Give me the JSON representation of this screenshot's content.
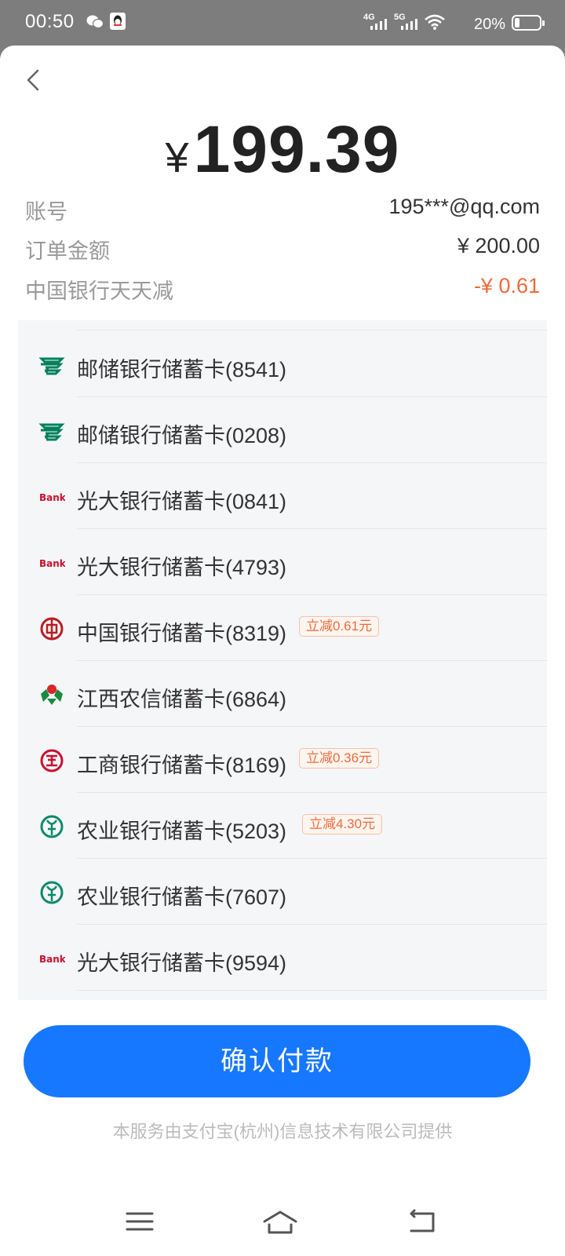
{
  "status": {
    "time": "00:50",
    "signal1": "4G",
    "signal2": "5G",
    "battery": "20%",
    "battery_level": 0.2
  },
  "header": {
    "back_icon": "chevron-left-icon"
  },
  "amount": {
    "currency": "¥",
    "value": "199.39"
  },
  "info": [
    {
      "label": "账号",
      "value": "195***@qq.com"
    },
    {
      "label": "订单金额",
      "value": "¥ 200.00"
    },
    {
      "label": "中国银行天天减",
      "value": "-¥ 0.61"
    }
  ],
  "banks": [
    {
      "name": "邮储银行储蓄卡(8541)",
      "logo": "psbc-icon",
      "promo": ""
    },
    {
      "name": "邮储银行储蓄卡(0208)",
      "logo": "psbc-icon",
      "promo": ""
    },
    {
      "name": "光大银行储蓄卡(0841)",
      "logo": "ceb-bank-icon",
      "promo": ""
    },
    {
      "name": "光大银行储蓄卡(4793)",
      "logo": "ceb-bank-icon",
      "promo": ""
    },
    {
      "name": "中国银行储蓄卡(8319)",
      "logo": "boc-icon",
      "promo": "立减0.61元"
    },
    {
      "name": "江西农信储蓄卡(6864)",
      "logo": "jxnx-icon",
      "promo": ""
    },
    {
      "name": "工商银行储蓄卡(8169)",
      "logo": "icbc-icon",
      "promo": "立减0.36元"
    },
    {
      "name": "农业银行储蓄卡(5203)",
      "logo": "abc-icon",
      "promo": "立减4.30元"
    },
    {
      "name": "农业银行储蓄卡(7607)",
      "logo": "abc-icon",
      "promo": ""
    },
    {
      "name": "光大银行储蓄卡(9594)",
      "logo": "ceb-bank-icon",
      "promo": ""
    }
  ],
  "bank_logo_text": "Bank",
  "confirm": {
    "label": "确认付款",
    "color": "#1677ff"
  },
  "footer": "本服务由支付宝(杭州)信息技术有限公司提供",
  "nav": {
    "menu_icon": "menu-icon",
    "home_icon": "home-icon",
    "back_icon": "back-icon"
  },
  "colors": {
    "accent": "#1677ff",
    "discount": "#ee6a3a"
  }
}
